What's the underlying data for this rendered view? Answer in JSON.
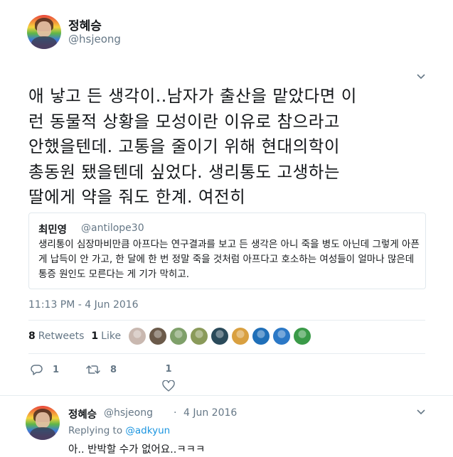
{
  "author": {
    "name": "정혜승",
    "handle": "@hsjeong"
  },
  "tweet": {
    "text_lines": [
      "애 낳고 든 생각이..남자가 출산을 맡았다면 이",
      "런 동물적 상황을 모성이란 이유로 참으라고",
      "안했을텐데. 고통을 줄이기 위해 현대의학이",
      "총동원 됐을텐데 싶었다. 생리통도 고생하는",
      "딸에게 약을 줘도 한계. 여전히"
    ]
  },
  "quote": {
    "name": "최민영",
    "handle": "@antilope30",
    "text": "생리통이 심장마비만큼 아프다는 연구결과를 보고 든 생각은 아니 죽을 병도 아닌데 그렇게 아픈 게 납득이 안 가고, 한 달에 한 번 정말 죽을 것처럼 아프다고 호소하는 여성들이 얼마나 많은데 통증 원인도 모른다는 게 기가 막히고."
  },
  "timestamp": "11:13 PM - 4 Jun 2016",
  "stats": {
    "retweets_count": "8",
    "retweets_label": "Retweets",
    "likes_count": "1",
    "likes_label": "Like"
  },
  "likers": [
    {
      "icon": "liker-avatar-1",
      "color": "#c9b8b0"
    },
    {
      "icon": "liker-avatar-2",
      "color": "#6b5a4a"
    },
    {
      "icon": "liker-avatar-3",
      "color": "#7fa06a"
    },
    {
      "icon": "liker-avatar-4",
      "color": "#8a9a5a"
    },
    {
      "icon": "liker-avatar-5",
      "color": "#2a4a5a"
    },
    {
      "icon": "liker-avatar-6",
      "color": "#d9a040"
    },
    {
      "icon": "liker-avatar-7",
      "color": "#1f6fb8"
    },
    {
      "icon": "liker-avatar-8",
      "color": "#2b78c6"
    },
    {
      "icon": "liker-avatar-9",
      "color": "#3a9a48"
    }
  ],
  "actions": {
    "reply_count": "1",
    "retweet_count": "8",
    "like_count": "1"
  },
  "reply": {
    "name": "정혜승",
    "handle": "@hsjeong",
    "separator": "·",
    "date": "4 Jun 2016",
    "replying_label": "Replying to",
    "replying_handle": "@adkyun",
    "text": "아.. 반박할 수가 없어요..ㅋㅋㅋ"
  },
  "colors": {
    "link": "#1b95e0",
    "muted": "#657786",
    "text": "#14171a",
    "border": "#e1e8ed"
  }
}
